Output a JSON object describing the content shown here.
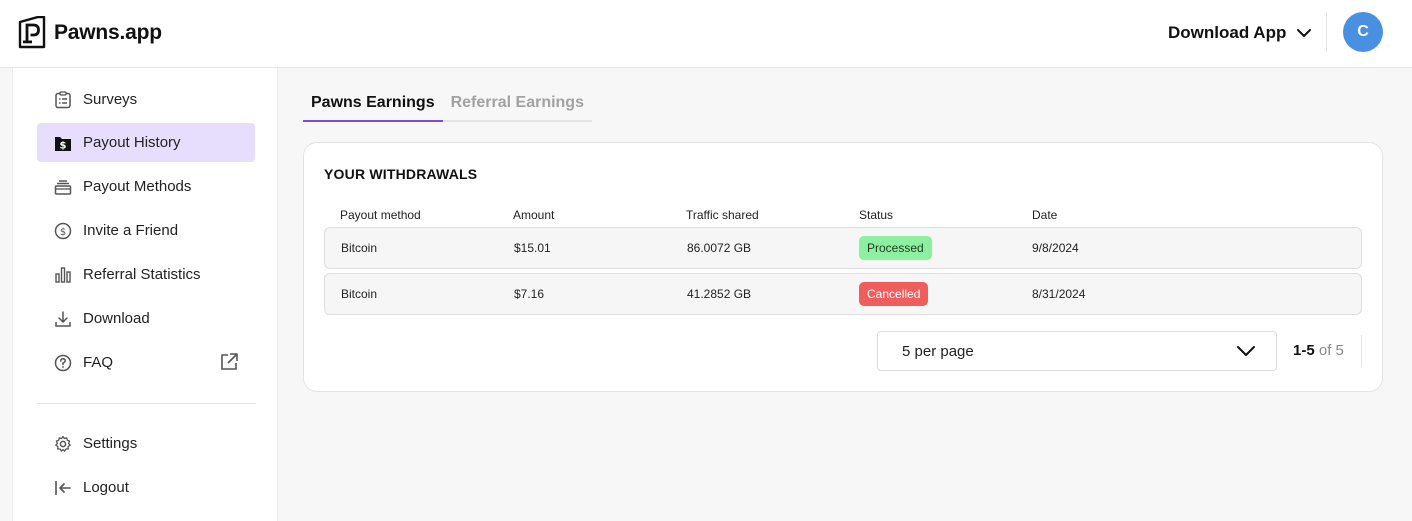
{
  "header": {
    "brand": "Pawns.app",
    "download_label": "Download App",
    "avatar_letter": "C"
  },
  "sidebar": {
    "items": [
      {
        "label": "Surveys",
        "icon": "clipboard-list-icon"
      },
      {
        "label": "Payout History",
        "icon": "dollar-folder-icon",
        "active": true
      },
      {
        "label": "Payout Methods",
        "icon": "cash-stack-icon"
      },
      {
        "label": "Invite a Friend",
        "icon": "dollar-circle-icon"
      },
      {
        "label": "Referral Statistics",
        "icon": "bar-chart-icon"
      },
      {
        "label": "Download",
        "icon": "download-icon"
      },
      {
        "label": "FAQ",
        "icon": "question-circle-icon",
        "external_icon": "external-link-icon"
      },
      {
        "label": "Settings",
        "icon": "gear-icon"
      },
      {
        "label": "Logout",
        "icon": "logout-icon"
      }
    ]
  },
  "tabs": [
    {
      "label": "Pawns Earnings",
      "active": true
    },
    {
      "label": "Referral Earnings",
      "active": false
    }
  ],
  "withdrawals": {
    "title": "YOUR WITHDRAWALS",
    "columns": [
      "Payout method",
      "Amount",
      "Traffic shared",
      "Status",
      "Date"
    ],
    "rows": [
      {
        "method": "Bitcoin",
        "amount": "$15.01",
        "traffic": "86.0072 GB",
        "status": "Processed",
        "date": "9/8/2024"
      },
      {
        "method": "Bitcoin",
        "amount": "$7.16",
        "traffic": "41.2852 GB",
        "status": "Cancelled",
        "date": "8/31/2024"
      }
    ],
    "per_page": "5 per page",
    "pager_range": "1-5",
    "pager_total": "of 5"
  },
  "colors": {
    "accent": "#7c4ddb",
    "active_nav_bg": "#e6defc",
    "processed": "#8cf0a0",
    "cancelled": "#f05d5d",
    "avatar": "#4a90e2"
  }
}
